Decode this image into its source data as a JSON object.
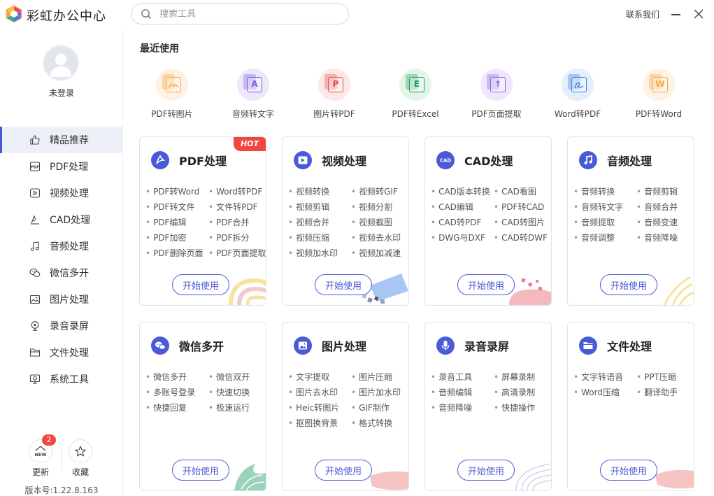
{
  "app": {
    "title": "彩虹办公中心"
  },
  "search": {
    "placeholder": "搜索工具"
  },
  "window": {
    "contact": "联系我们"
  },
  "user": {
    "login": "未登录"
  },
  "sidebar": {
    "items": [
      {
        "label": "精品推荐",
        "icon": "thumbs-up-icon",
        "active": true
      },
      {
        "label": "PDF处理",
        "icon": "pdf-icon"
      },
      {
        "label": "视频处理",
        "icon": "video-icon"
      },
      {
        "label": "CAD处理",
        "icon": "cad-icon"
      },
      {
        "label": "音频处理",
        "icon": "music-icon"
      },
      {
        "label": "微信多开",
        "icon": "wechat-icon"
      },
      {
        "label": "图片处理",
        "icon": "image-icon"
      },
      {
        "label": "录音录屏",
        "icon": "record-icon"
      },
      {
        "label": "文件处理",
        "icon": "folder-icon"
      },
      {
        "label": "系统工具",
        "icon": "system-icon"
      }
    ],
    "update_label": "更新",
    "update_badge": "2",
    "update_icon_text": "NEW",
    "favorite_label": "收藏",
    "version": "版本号:1.22.8.163"
  },
  "recent": {
    "title": "最近使用",
    "items": [
      {
        "label": "PDF转图片",
        "color": "#f4a63a",
        "bg": "#fdf2e3",
        "glyph": ""
      },
      {
        "label": "音频转文字",
        "color": "#7a5de0",
        "bg": "#ede8fb",
        "glyph": "A"
      },
      {
        "label": "图片转PDF",
        "color": "#ea4b4b",
        "bg": "#fde7e7",
        "glyph": "P"
      },
      {
        "label": "PDF转Excel",
        "color": "#1f9d55",
        "bg": "#e3f5eb",
        "glyph": "E"
      },
      {
        "label": "PDF页面提取",
        "color": "#8a63e6",
        "bg": "#efe8fc",
        "glyph": "↑"
      },
      {
        "label": "Word转PDF",
        "color": "#3f7fe0",
        "bg": "#e4eefc",
        "glyph": ""
      },
      {
        "label": "PDF转Word",
        "color": "#f4a63a",
        "bg": "#fdf2e3",
        "glyph": "W"
      }
    ]
  },
  "cards": [
    {
      "title": "PDF处理",
      "icon": "pdf-icon",
      "hot": "HOT",
      "features": [
        "PDF转Word",
        "Word转PDF",
        "PDF转文件",
        "文件转PDF",
        "PDF编辑",
        "PDF合并",
        "PDF加密",
        "PDF拆分",
        "PDF删除页面",
        "PDF页面提取"
      ],
      "button": "开始使用"
    },
    {
      "title": "视频处理",
      "icon": "video-icon",
      "features": [
        "视频转换",
        "视频转GIF",
        "视频剪辑",
        "视频分割",
        "视频合并",
        "视频截图",
        "视频压缩",
        "视频去水印",
        "视频加水印",
        "视频加减速"
      ],
      "button": "开始使用"
    },
    {
      "title": "CAD处理",
      "icon": "cad-icon",
      "icon_text": "CAD",
      "features": [
        "CAD版本转换",
        "CAD看图",
        "CAD编辑",
        "PDF转CAD",
        "CAD转PDF",
        "CAD转图片",
        "DWG与DXF",
        "CAD转DWF"
      ],
      "button": "开始使用"
    },
    {
      "title": "音频处理",
      "icon": "music-icon",
      "features": [
        "音频转换",
        "音频剪辑",
        "音频转文字",
        "音频合并",
        "音频提取",
        "音频变速",
        "音频调整",
        "音频降噪"
      ],
      "button": "开始使用"
    },
    {
      "title": "微信多开",
      "icon": "wechat-icon",
      "features": [
        "微信多开",
        "微信双开",
        "多账号登录",
        "快速切换",
        "快捷回复",
        "极速运行"
      ],
      "button": "开始使用"
    },
    {
      "title": "图片处理",
      "icon": "image-icon",
      "features": [
        "文字提取",
        "图片压缩",
        "图片去水印",
        "图片加水印",
        "Heic转图片",
        "GIF制作",
        "抠图换背景",
        "格式转换"
      ],
      "button": "开始使用"
    },
    {
      "title": "录音录屏",
      "icon": "microphone-icon",
      "features": [
        "录音工具",
        "屏幕录制",
        "音频编辑",
        "高清录制",
        "音频降噪",
        "快捷操作"
      ],
      "button": "开始使用"
    },
    {
      "title": "文件处理",
      "icon": "folder-icon",
      "features": [
        "文字转语音",
        "PPT压缩",
        "Word压缩",
        "翻译助手"
      ],
      "button": "开始使用"
    }
  ],
  "colors": {
    "accent": "#4a5bd8",
    "hot": "#f0473f"
  }
}
